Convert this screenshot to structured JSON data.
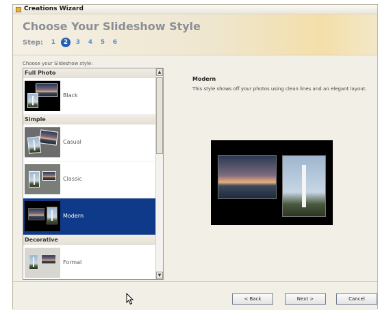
{
  "window": {
    "title": "Creations Wizard"
  },
  "header": {
    "heading": "Choose Your Slideshow Style",
    "step_label": "Step:",
    "steps": [
      "1",
      "2",
      "3",
      "4",
      "5",
      "6"
    ],
    "active_step": "2"
  },
  "list": {
    "label": "Choose your Slideshow style:",
    "groups": [
      {
        "name": "Full Photo",
        "items": [
          "Black"
        ]
      },
      {
        "name": "Simple",
        "items": [
          "Casual",
          "Classic",
          "Modern"
        ]
      },
      {
        "name": "Decorative",
        "items": [
          "Formal"
        ]
      }
    ],
    "selected": "Modern"
  },
  "preview": {
    "title": "Modern",
    "description": "This style shows off your photos using clean lines and an elegant layout."
  },
  "buttons": {
    "back": "< Back",
    "next": "Next >",
    "cancel": "Cancel"
  },
  "colors": {
    "selection": "#0f3a8a",
    "step_active": "#2560b0",
    "step_link": "#5a8fd0"
  }
}
